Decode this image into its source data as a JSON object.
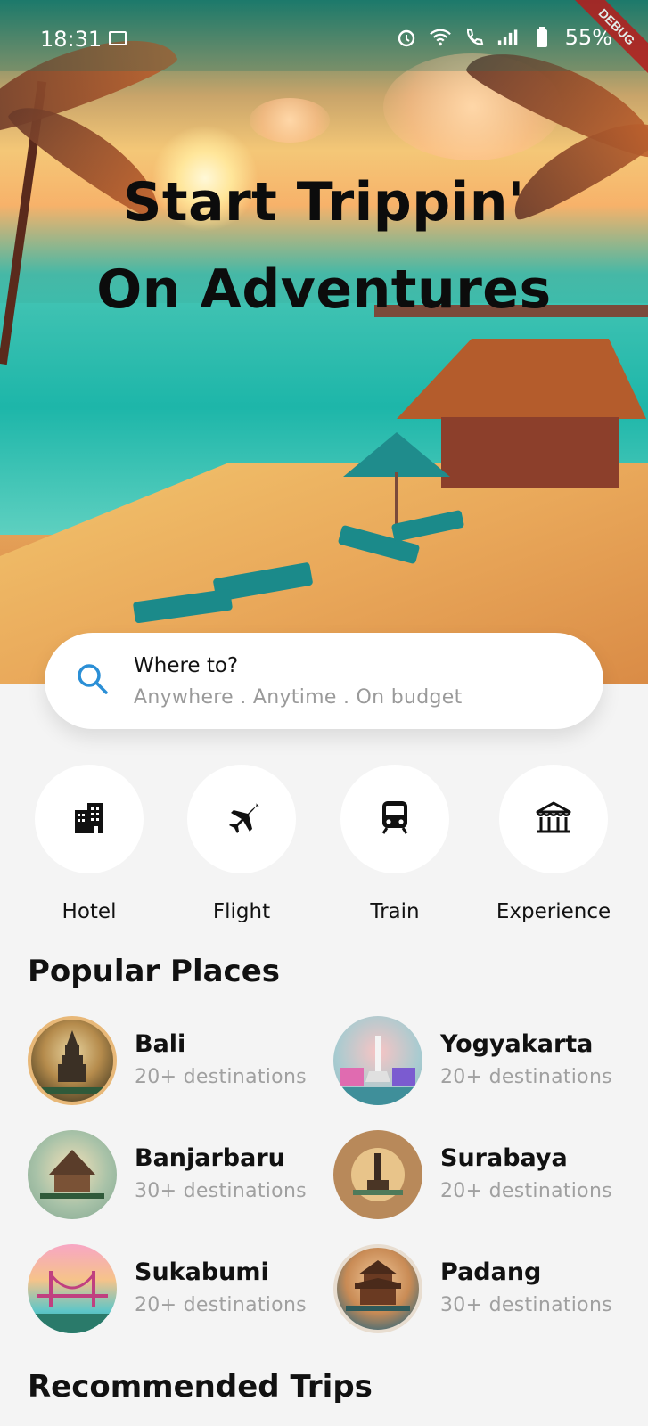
{
  "status_bar": {
    "time": "18:31",
    "battery": "55%",
    "debug_label": "DEBUG",
    "icons": [
      "calendar-icon",
      "alarm-icon",
      "wifi-icon",
      "call-icon",
      "signal-icon",
      "battery-icon"
    ]
  },
  "hero": {
    "title_line1": "Start Trippin'",
    "title_line2": "On Adventures"
  },
  "search": {
    "title": "Where to?",
    "subtitle": "Anywhere . Anytime . On budget",
    "icon": "search-icon"
  },
  "categories": [
    {
      "label": "Hotel",
      "icon": "hotel-icon"
    },
    {
      "label": "Flight",
      "icon": "flight-icon"
    },
    {
      "label": "Train",
      "icon": "train-icon"
    },
    {
      "label": "Experience",
      "icon": "experience-icon"
    }
  ],
  "popular": {
    "title": "Popular Places",
    "places": [
      {
        "name": "Bali",
        "destinations": "20+ destinations"
      },
      {
        "name": "Yogyakarta",
        "destinations": "20+ destinations"
      },
      {
        "name": "Banjarbaru",
        "destinations": "30+ destinations"
      },
      {
        "name": "Surabaya",
        "destinations": "20+ destinations"
      },
      {
        "name": "Sukabumi",
        "destinations": "20+ destinations"
      },
      {
        "name": "Padang",
        "destinations": "30+ destinations"
      }
    ]
  },
  "recommended": {
    "title": "Recommended Trips"
  },
  "colors": {
    "accent": "#2b8fd6",
    "background": "#f4f4f4",
    "muted_text": "#a0a0a0"
  }
}
